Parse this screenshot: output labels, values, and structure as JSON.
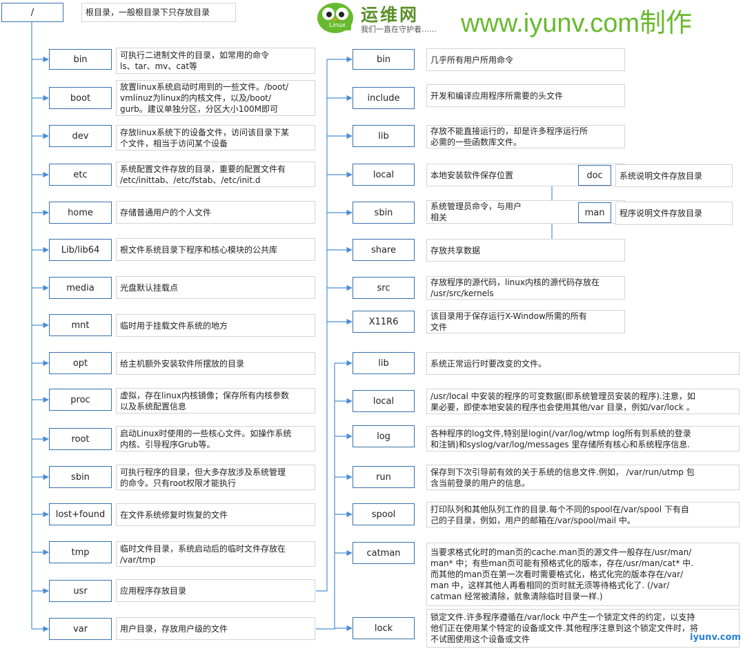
{
  "header": {
    "brand_site": "www.iyunv.com制作",
    "logo_title": "运维网",
    "logo_slogan": "我们一直在守护着……",
    "logo_badge": "Linux",
    "watermark": "iyunv.com"
  },
  "root": {
    "label": "/",
    "desc": "根目录，一般根目录下只存放目录"
  },
  "left_column": [
    {
      "label": "bin",
      "lines": [
        "可执行二进制文件的目录，如常用的命令",
        "ls、tar、mv、cat等"
      ]
    },
    {
      "label": "boot",
      "lines": [
        "放置linux系统启动时用到的一些文件。/boot/",
        "vmlinuz为linux的内核文件，以及/boot/",
        "gurb。建议单独分区，分区大小100M即可"
      ]
    },
    {
      "label": "dev",
      "lines": [
        "存放linux系统下的设备文件，访问该目录下某",
        "个文件，相当于访问某个设备"
      ]
    },
    {
      "label": "etc",
      "lines": [
        "系统配置文件存放的目录，重要的配置文件有",
        "/etc/inittab、/etc/fstab、/etc/init.d"
      ]
    },
    {
      "label": "home",
      "lines": [
        "存储普通用户的个人文件"
      ]
    },
    {
      "label": "Lib/lib64",
      "lines": [
        "根文件系统目录下程序和核心模块的公共库"
      ]
    },
    {
      "label": "media",
      "lines": [
        "光盘默认挂载点"
      ]
    },
    {
      "label": "mnt",
      "lines": [
        "临时用于挂载文件系统的地方"
      ]
    },
    {
      "label": "opt",
      "lines": [
        "给主机额外安装软件所摆放的目录"
      ]
    },
    {
      "label": "proc",
      "lines": [
        "虚拟，存在linux内核镜像；保存所有内核参数",
        "以及系统配置信息"
      ]
    },
    {
      "label": "root",
      "lines": [
        "启动Linux时使用的一些核心文件。如操作系统",
        "内核、引导程序Grub等。"
      ]
    },
    {
      "label": "sbin",
      "lines": [
        "可执行程序的目录，但大多存放涉及系统管理",
        "的命令。只有root权限才能执行"
      ]
    },
    {
      "label": "lost+found",
      "lines": [
        "在文件系统修复时恢复的文件"
      ]
    },
    {
      "label": "tmp",
      "lines": [
        "临时文件目录，系统启动后的临时文件存放在",
        "/var/tmp"
      ]
    },
    {
      "label": "usr",
      "lines": [
        "应用程序存放目录"
      ]
    },
    {
      "label": "var",
      "lines": [
        "用户目录，存放用户级的文件"
      ]
    }
  ],
  "usr_column": [
    {
      "label": "bin",
      "lines": [
        "几乎所有用户所用命令"
      ]
    },
    {
      "label": "include",
      "lines": [
        "开发和编译应用程序所需要的头文件"
      ]
    },
    {
      "label": "lib",
      "lines": [
        "存放不能直接运行的，却是许多程序运行所",
        "必需的一些函数库文件。"
      ]
    },
    {
      "label": "local",
      "lines": [
        "本地安装软件保存位置"
      ]
    },
    {
      "label": "sbin",
      "lines": [
        "系统管理员命令，与用户",
        "相关"
      ]
    },
    {
      "label": "share",
      "lines": [
        "存放共享数据"
      ]
    },
    {
      "label": "src",
      "lines": [
        "存放程序的源代码，linux内核的源代码存放在",
        "/usr/src/kernels"
      ]
    },
    {
      "label": "X11R6",
      "lines": [
        "该目录用于保存运行X-Window所需的所有",
        "文件"
      ]
    }
  ],
  "share_column": [
    {
      "label": "doc",
      "lines": [
        "系统说明文件存放目录"
      ]
    },
    {
      "label": "man",
      "lines": [
        "程序说明文件存放目录"
      ]
    }
  ],
  "var_column": [
    {
      "label": "lib",
      "lines": [
        "系统正常运行时要改变的文件。"
      ]
    },
    {
      "label": "local",
      "lines": [
        "/usr/local 中安装的程序的可变数据(即系统管理员安装的程序).注意，如",
        "果必要，即使本地安装的程序也会使用其他/var 目录，例如/var/lock 。"
      ]
    },
    {
      "label": "log",
      "lines": [
        "各种程序的log文件,特别是login(/var/log/wtmp log所有到系统的登录",
        "和注销)和syslog/var/log/messages 里存储所有核心和系统程序信息."
      ]
    },
    {
      "label": "run",
      "lines": [
        "保存到下次引导前有效的关于系统的信息文件.例如， /var/run/utmp 包",
        "含当前登录的用户的信息。"
      ]
    },
    {
      "label": "spool",
      "lines": [
        "打印队列和其他队列工作的目录.每个不同的spool在/var/spool 下有自",
        "己的子目录，例如，用户的邮箱在/var/spool/mail 中。"
      ]
    },
    {
      "label": "catman",
      "lines": [
        "当要求格式化时的man页的cache.man页的源文件一般存在/usr/man/",
        "man* 中；有些man页可能有预格式化的版本，存在/usr/man/cat* 中.",
        "而其他的man页在第一次看时需要格式化，格式化完的版本存在/var/",
        "man 中，这样其他人再看相同的页时就无须等待格式化了. (/var/",
        "catman 经常被清除，就象清除临时目录一样.)"
      ]
    },
    {
      "label": "lock",
      "lines": [
        "锁定文件.许多程序遵循在/var/lock 中产生一个锁定文件的约定，以支持",
        "他们正在使用某个特定的设备或文件.其他程序注意到这个锁定文件时，将",
        "不试图使用这个设备或文件"
      ]
    }
  ],
  "colors": {
    "box_border": "#3a6fa8",
    "connector": "#4a8fd6",
    "desc_border": "#d4d4d4",
    "brand_green": "#67ba2d"
  }
}
